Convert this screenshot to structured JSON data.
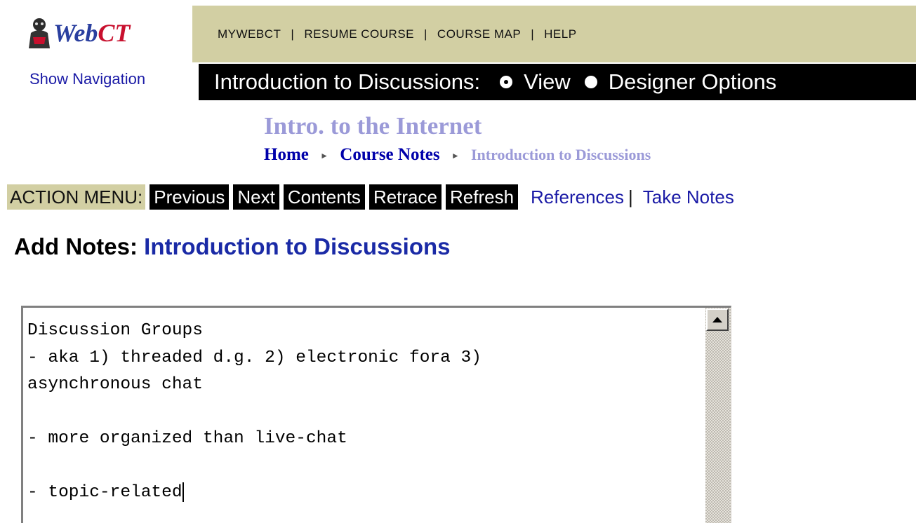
{
  "logo": {
    "text_web": "Web",
    "text_ct": "CT"
  },
  "topnav": {
    "items": [
      "MYWEBCT",
      "RESUME COURSE",
      "COURSE MAP",
      "HELP"
    ],
    "separator": "|"
  },
  "show_navigation": "Show Navigation",
  "titlebar": {
    "page_title": "Introduction to Discussions:",
    "options": [
      {
        "label": "View",
        "selected": true
      },
      {
        "label": "Designer Options",
        "selected": false
      }
    ]
  },
  "course_title": "Intro. to the Internet",
  "breadcrumb": {
    "items": [
      "Home",
      "Course Notes"
    ],
    "current": "Introduction to Discussions"
  },
  "action_menu": {
    "label": "ACTION MENU:",
    "buttons": [
      "Previous",
      "Next",
      "Contents",
      "Retrace",
      "Refresh"
    ],
    "links": [
      "References",
      "Take Notes"
    ],
    "separator": "|"
  },
  "heading": {
    "prefix": "Add Notes:",
    "topic": "Introduction to Discussions"
  },
  "notes": {
    "text": "Discussion Groups\n- aka 1) threaded d.g. 2) electronic fora 3)\nasynchronous chat\n\n- more organized than live-chat\n\n- topic-related"
  },
  "colors": {
    "nav_bg": "#d2cfa3",
    "link": "#1a1aa6",
    "course_title": "#9b9ad8",
    "titlebar_bg": "#000000"
  }
}
